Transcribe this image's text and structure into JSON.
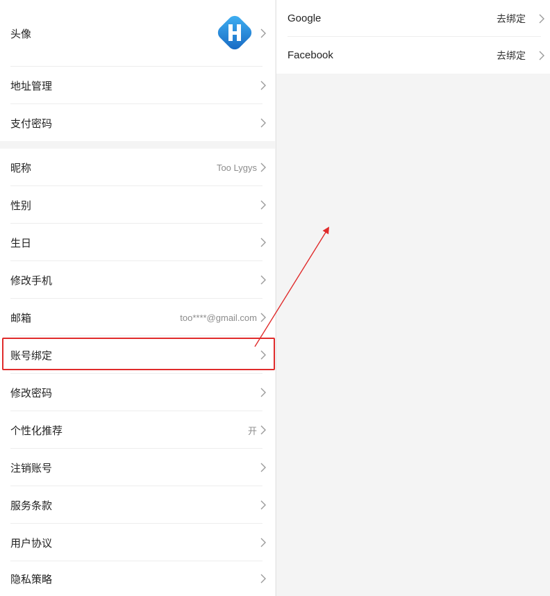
{
  "profile_settings": {
    "group1": [
      {
        "key": "avatar",
        "label": "头像"
      },
      {
        "key": "address",
        "label": "地址管理"
      },
      {
        "key": "pay_password",
        "label": "支付密码"
      }
    ],
    "group2": [
      {
        "key": "nickname",
        "label": "昵称",
        "value": "Too Lygys"
      },
      {
        "key": "gender",
        "label": "性别"
      },
      {
        "key": "birthday",
        "label": "生日"
      },
      {
        "key": "change_phone",
        "label": "修改手机"
      },
      {
        "key": "email",
        "label": "邮箱",
        "value": "too****@gmail.com"
      },
      {
        "key": "account_binding",
        "label": "账号绑定"
      },
      {
        "key": "change_password",
        "label": "修改密码"
      },
      {
        "key": "personalized",
        "label": "个性化推荐",
        "value": "开"
      },
      {
        "key": "cancel_account",
        "label": "注销账号"
      },
      {
        "key": "terms",
        "label": "服务条款"
      },
      {
        "key": "user_agreement",
        "label": "用户协议"
      },
      {
        "key": "privacy",
        "label": "隐私策略"
      }
    ]
  },
  "account_binding": {
    "items": [
      {
        "platform": "Google",
        "action": "去绑定"
      },
      {
        "platform": "Facebook",
        "action": "去绑定"
      }
    ]
  },
  "colors": {
    "highlight": "#e02b2b",
    "avatar_brand": "#1e88e5"
  },
  "icons": {
    "chevron": "chevron-right-icon",
    "avatar": "app-logo-icon"
  }
}
